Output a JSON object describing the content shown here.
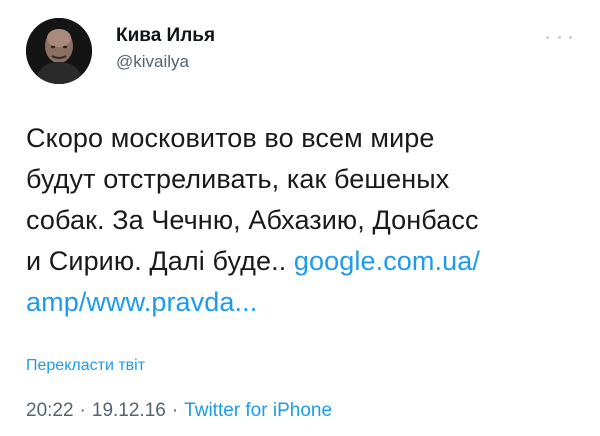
{
  "author": {
    "display_name": "Кива Илья",
    "handle": "@kivailya"
  },
  "tweet": {
    "lines": [
      "Скоро московитов во всем мире",
      "будут отстреливать, как бешеных",
      "собак. За Чечню, Абхазию, Донбасс"
    ],
    "line4_text": "и Сирию. Далі буде.. ",
    "link_part1": "google.com.ua/",
    "link_part2": "amp/www.pravda..."
  },
  "translate_label": "Перекласти твіт",
  "meta": {
    "time": "20:22",
    "separator1": "·",
    "date": "19.12.16",
    "separator2": "·",
    "source": "Twitter for iPhone"
  },
  "icons": {
    "more": "more-horizontal-icon",
    "avatar": "avatar"
  },
  "colors": {
    "link": "#1d9bf0",
    "secondary": "#536471",
    "text": "#0f1419"
  }
}
